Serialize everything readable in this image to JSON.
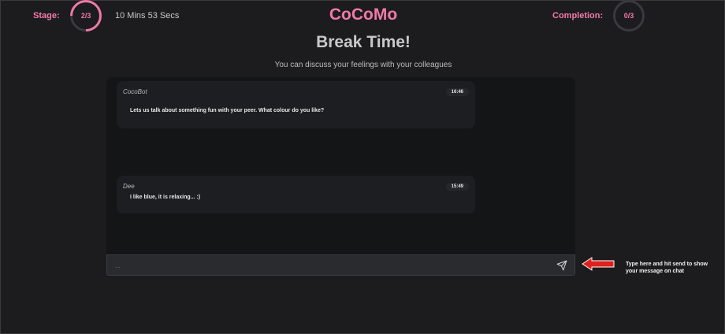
{
  "header": {
    "stage_label": "Stage:",
    "stage_value": "2/3",
    "timer": "10 Mins  53 Secs",
    "brand": "CoCoMo",
    "completion_label": "Completion:",
    "completion_value": "0/3"
  },
  "main": {
    "title": "Break Time!",
    "subtitle": "You can discuss your feelings with your colleagues"
  },
  "chat": {
    "messages": [
      {
        "sender": "CocoBot",
        "time": "16:46",
        "text": "Lets us talk about something fun with your peer. What colour do you like?"
      },
      {
        "sender": "Dee",
        "time": "15:49",
        "text": "I like blue, it is relaxing... :)"
      }
    ],
    "input_placeholder": "...",
    "send_icon": "send-icon"
  },
  "annotation": {
    "hint": "Type here and hit send to show your message on chat",
    "arrow_color": "#e02020"
  },
  "colors": {
    "accent": "#f07aa6",
    "background": "#1c1c1f",
    "panel": "#141517"
  }
}
